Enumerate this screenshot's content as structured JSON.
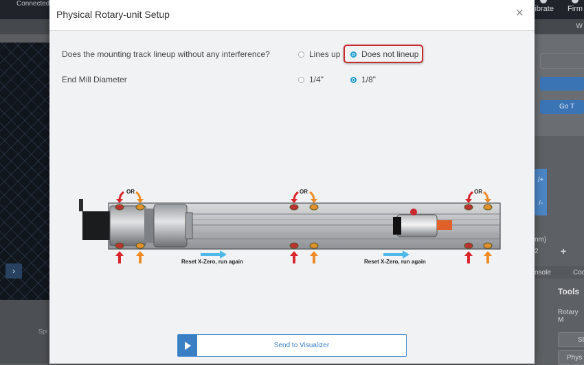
{
  "background": {
    "topbar": {
      "connection_status": "Connected",
      "calibrate": "librate",
      "firmware": "Firm"
    },
    "subbar_right": "W",
    "right_panel": {
      "go_label": "Go T",
      "hex_up": "/+",
      "hex_down": "/-",
      "unit_text": "nm)",
      "value": "2",
      "plus": "+",
      "console_tab": "nsole",
      "code_tab": "Coo",
      "tools_heading": "Tools",
      "rotary_label": "Rotary M",
      "phys_btn": "Phys",
      "st_btn": "St"
    },
    "left_panel": {
      "spindle_label": "Spi",
      "nav_arrow": "›"
    }
  },
  "modal": {
    "title": "Physical Rotary-unit Setup",
    "close_glyph": "×",
    "questions": [
      {
        "label": "Does the mounting track lineup without any interference?",
        "options": [
          {
            "label": "Lines up",
            "selected": false
          },
          {
            "label": "Does not lineup",
            "selected": true
          }
        ]
      },
      {
        "label": "End Mill Diameter",
        "options": [
          {
            "label": "1/4\"",
            "selected": false
          },
          {
            "label": "1/8\"",
            "selected": true
          }
        ]
      }
    ],
    "diagram": {
      "or_label": "OR",
      "reset_caption": "Reset X-Zero, run again",
      "colors": {
        "red_arrow": "#d8262c",
        "orange_arrow": "#f08a24",
        "blue_arrow": "#4db8ea"
      }
    },
    "send_button": {
      "label": "Send to Visualizer",
      "icon": "play-icon"
    }
  },
  "colors": {
    "accent": "#1d9bd1",
    "highlight_border": "#c9282d",
    "button_blue": "#3a7ec4"
  }
}
